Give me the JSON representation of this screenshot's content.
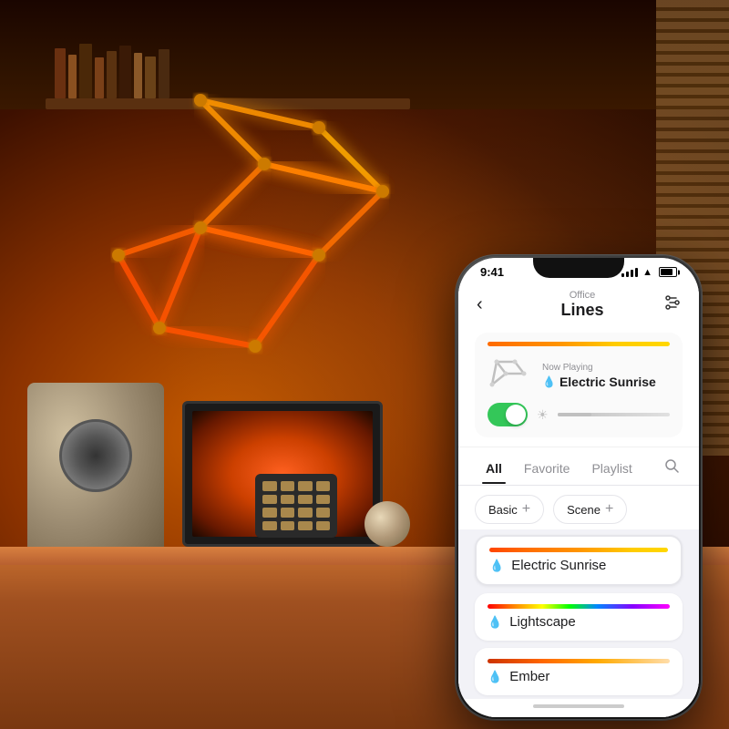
{
  "background": {
    "description": "Warm orange office room with Nanoleaf Lines on wall"
  },
  "phone": {
    "status_bar": {
      "time": "9:41",
      "battery_label": "battery"
    },
    "nav": {
      "back_icon": "‹",
      "subtitle": "Office",
      "title": "Lines",
      "settings_icon": "⚙"
    },
    "now_playing": {
      "label": "Now Playing",
      "scene_name": "Electric Sunrise",
      "color_strip": "linear-gradient(90deg, #ff6b00 0%, #ff9500 40%, #ffcc00 100%)"
    },
    "toggle": {
      "is_on": true,
      "brightness_level": 30
    },
    "tabs": [
      {
        "label": "All",
        "active": true
      },
      {
        "label": "Favorite",
        "active": false
      },
      {
        "label": "Playlist",
        "active": false
      }
    ],
    "search_icon": "🔍",
    "filters": [
      {
        "label": "Basic",
        "plus": "+"
      },
      {
        "label": "Scene",
        "plus": "+"
      }
    ],
    "scenes": [
      {
        "name": "Electric Sunrise",
        "gradient": "linear-gradient(90deg, #ff4500 0%, #ff6b00 20%, #ff9500 50%, #ffcc00 80%, #ffd700 100%)",
        "active": true
      },
      {
        "name": "Lightscape",
        "gradient": "linear-gradient(90deg, #ff0000 0%, #ff8800 15%, #ffff00 30%, #00ff00 45%, #0088ff 60%, #8800ff 80%, #ff00ff 100%)",
        "active": false
      },
      {
        "name": "Ember",
        "gradient": "linear-gradient(90deg, #cc3300 0%, #ff6600 30%, #ffaa00 60%, #ffddaa 100%)",
        "active": false
      }
    ]
  }
}
